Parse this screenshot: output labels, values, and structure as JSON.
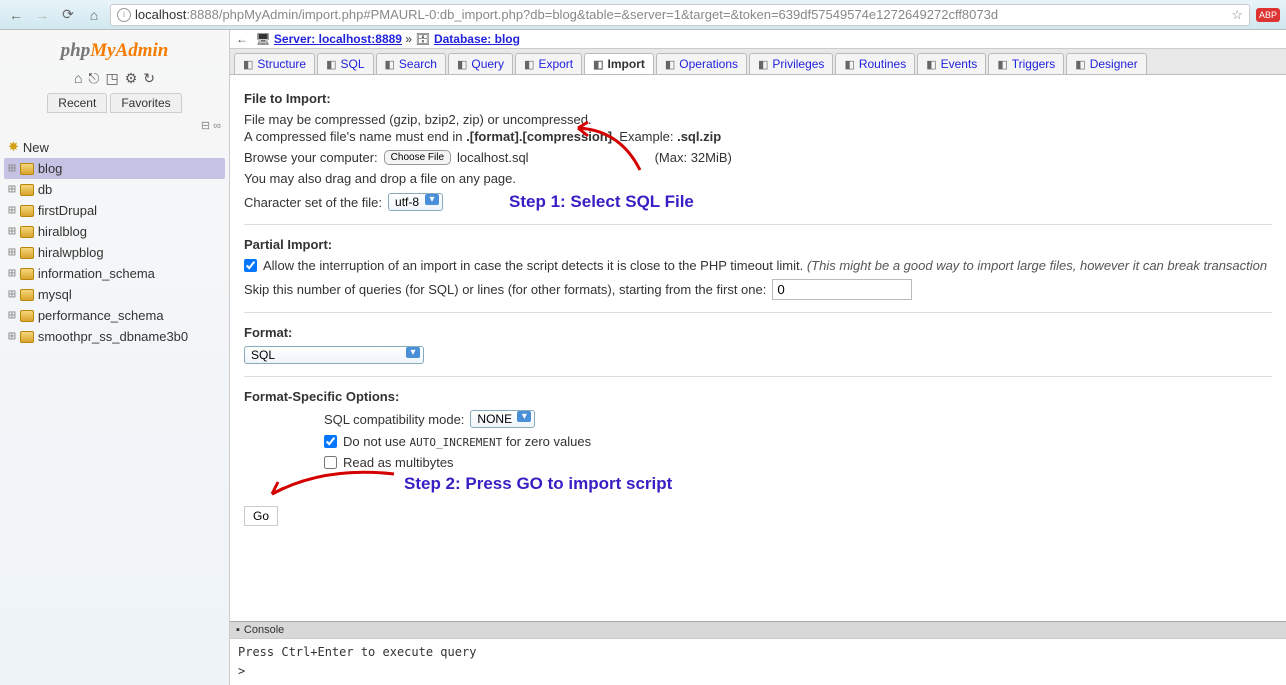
{
  "browser": {
    "url_domain": "localhost",
    "url_path": ":8888/phpMyAdmin/import.php#PMAURL-0:db_import.php?db=blog&table=&server=1&target=&token=639df57549574e1272649272cff8073d",
    "star": "☆",
    "abp": "ABP"
  },
  "sidebar": {
    "logo_php": "php",
    "logo_my": "My",
    "logo_admin": "Admin",
    "tabs": {
      "recent": "Recent",
      "favorites": "Favorites"
    },
    "tree": [
      {
        "label": "New",
        "new": true
      },
      {
        "label": "blog",
        "selected": true
      },
      {
        "label": "db"
      },
      {
        "label": "firstDrupal"
      },
      {
        "label": "hiralblog"
      },
      {
        "label": "hiralwpblog"
      },
      {
        "label": "information_schema"
      },
      {
        "label": "mysql"
      },
      {
        "label": "performance_schema"
      },
      {
        "label": "smoothpr_ss_dbname3b0"
      }
    ]
  },
  "breadcrumb": {
    "server_label": "Server: localhost:8889",
    "db_label": "Database: blog",
    "sep": "»"
  },
  "tabs": [
    {
      "label": "Structure"
    },
    {
      "label": "SQL"
    },
    {
      "label": "Search"
    },
    {
      "label": "Query"
    },
    {
      "label": "Export"
    },
    {
      "label": "Import",
      "active": true
    },
    {
      "label": "Operations"
    },
    {
      "label": "Privileges"
    },
    {
      "label": "Routines"
    },
    {
      "label": "Events"
    },
    {
      "label": "Triggers"
    },
    {
      "label": "Designer"
    }
  ],
  "importForm": {
    "section_file": "File to Import:",
    "note1": "File may be compressed (gzip, bzip2, zip) or uncompressed.",
    "note2a": "A compressed file's name must end in ",
    "note2b": ".[format].[compression]",
    "note2c": ". Example: ",
    "note2d": ".sql.zip",
    "browse_label": "Browse your computer:",
    "choose_btn": "Choose File",
    "chosen_file": "localhost.sql",
    "max": "(Max: 32MiB)",
    "drag": "You may also drag and drop a file on any page.",
    "charset_label": "Character set of the file:",
    "charset_value": "utf-8",
    "section_partial": "Partial Import:",
    "partial_text": "Allow the interruption of an import in case the script detects it is close to the PHP timeout limit. ",
    "partial_italic": "(This might be a good way to import large files, however it can break transaction",
    "skip_label": "Skip this number of queries (for SQL) or lines (for other formats), starting from the first one:",
    "skip_value": "0",
    "section_format": "Format:",
    "format_value": "SQL",
    "section_format_opts": "Format-Specific Options:",
    "compat_label": "SQL compatibility mode:",
    "compat_value": "NONE",
    "auto_inc_a": "Do not use ",
    "auto_inc_b": "AUTO_INCREMENT",
    "auto_inc_c": " for zero values",
    "multibytes": "Read as multibytes",
    "go": "Go"
  },
  "annotations": {
    "step1": "Step 1: Select SQL File",
    "step2": "Step 2: Press GO to import script"
  },
  "console": {
    "header": "Console",
    "line1": "Press Ctrl+Enter to execute query",
    "prompt": ">"
  }
}
